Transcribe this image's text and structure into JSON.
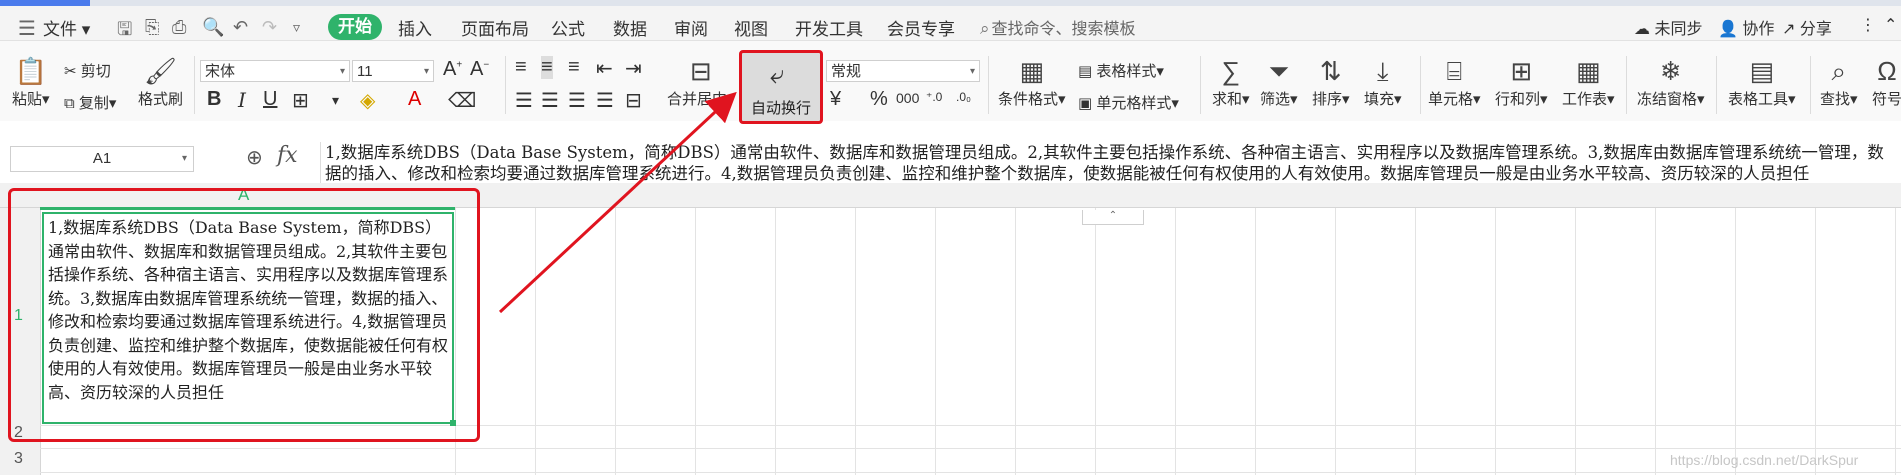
{
  "menubar": {
    "file_menu": "文件",
    "tabs": [
      "开始",
      "插入",
      "页面布局",
      "公式",
      "数据",
      "审阅",
      "视图",
      "开发工具",
      "会员专享"
    ],
    "active_tab": "开始",
    "search_text": "查找命令、搜索模板",
    "sync": "未同步",
    "collab": "协作",
    "share": "分享"
  },
  "ribbon": {
    "paste": "粘贴",
    "cut": "剪切",
    "copy": "复制",
    "format_painter": "格式刷",
    "font_name": "宋体",
    "font_size": "11",
    "merge_center": "合并居中",
    "wrap_text": "自动换行",
    "number_format": "常规",
    "conditional_format": "条件格式",
    "table_style": "表格样式",
    "cell_style": "单元格样式",
    "sum": "求和",
    "filter": "筛选",
    "sort": "排序",
    "fill": "填充",
    "cells": "单元格",
    "row_col": "行和列",
    "worksheet": "工作表",
    "freeze": "冻结窗格",
    "table_tools": "表格工具",
    "find": "查找",
    "symbol": "符号"
  },
  "formula_bar": {
    "name_box": "A1",
    "fx": "fx",
    "content": "1,数据库系统DBS（Data Base System，简称DBS）通常由软件、数据库和数据管理员组成。2,其软件主要包括操作系统、各种宿主语言、实用程序以及数据库管理系统。3,数据库由数据库管理系统统一管理，数据的插入、修改和检索均要通过数据库管理系统进行。4,数据管理员负责创建、监控和维护整个数据库，使数据能被任何有权使用的人有效使用。数据库管理员一般是由业务水平较高、资历较深的人员担任"
  },
  "sheet": {
    "column_header": "A",
    "row_labels": [
      "1",
      "2",
      "3"
    ],
    "cell_A1": "1,数据库系统DBS（Data Base System，简称DBS）通常由软件、数据库和数据管理员组成。2,其软件主要包括操作系统、各种宿主语言、实用程序以及数据库管理系统。3,数据库由数据库管理系统统一管理，数据的插入、修改和检索均要通过数据库管理系统进行。4,数据管理员负责创建、监控和维护整个数据库，使数据能被任何有权使用的人有效使用。数据库管理员一般是由业务水平较高、资历较深的人员担任"
  },
  "watermark": "https://blog.csdn.net/DarkSpur",
  "colors": {
    "accent_green": "#2fb36b",
    "annotation_red": "#e0141f"
  }
}
